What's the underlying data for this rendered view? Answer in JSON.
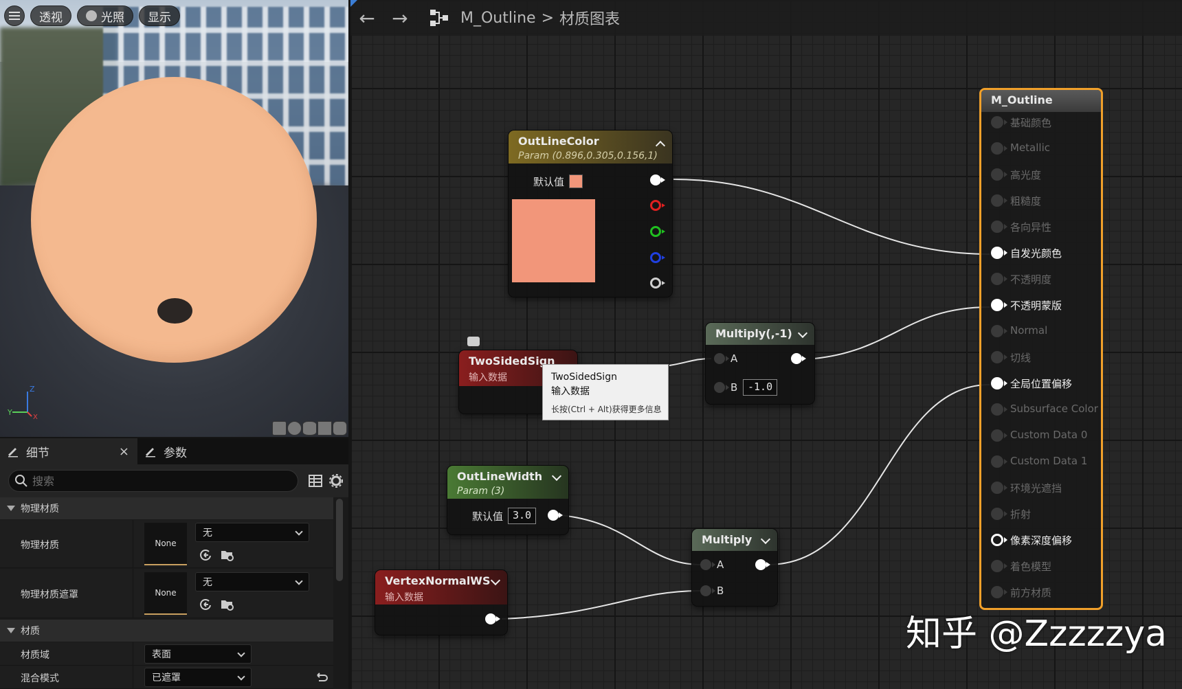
{
  "viewport": {
    "menu_icon": "hamburger-icon",
    "buttons": {
      "perspective": "透视",
      "lighting": "光照",
      "show": "显示"
    }
  },
  "details": {
    "tabs": {
      "details": "细节",
      "close": "×",
      "params": "参数"
    },
    "search": {
      "placeholder": "搜索"
    },
    "categories": {
      "physical_material": "物理材质",
      "material": "材质"
    },
    "rows": {
      "phys_mat": {
        "label": "物理材质",
        "thumb": "None",
        "value": "无"
      },
      "phys_mat_mask": {
        "label": "物理材质遮罩",
        "thumb": "None",
        "value": "无"
      },
      "material_domain": {
        "label": "材质域",
        "value": "表面"
      },
      "blend_mode": {
        "label": "混合模式",
        "value": "已遮罩"
      }
    }
  },
  "graph": {
    "breadcrumb": {
      "asset": "M_Outline",
      "separator": ">",
      "page": "材质图表"
    },
    "nodes": {
      "outline_color": {
        "title": "OutLineColor",
        "sub": "Param (0.896,0.305,0.156,1)",
        "default_label": "默认值",
        "swatch": "#f2967a"
      },
      "two_sided": {
        "title": "TwoSidedSign",
        "sub": "输入数据"
      },
      "multiply_neg": {
        "title": "Multiply(,-1)",
        "pin_a": "A",
        "pin_b": "B",
        "b_value": "-1.0"
      },
      "outline_width": {
        "title": "OutLineWidth",
        "sub": "Param (3)",
        "default_label": "默认值",
        "value": "3.0"
      },
      "multiply": {
        "title": "Multiply",
        "pin_a": "A",
        "pin_b": "B"
      },
      "vertex_normal": {
        "title": "VertexNormalWS",
        "sub": "输入数据"
      }
    },
    "result": {
      "title": "M_Outline",
      "pins": [
        {
          "label": "基础颜色",
          "active": false
        },
        {
          "label": "Metallic",
          "active": false
        },
        {
          "label": "高光度",
          "active": false
        },
        {
          "label": "粗糙度",
          "active": false
        },
        {
          "label": "各向异性",
          "active": false
        },
        {
          "label": "自发光颜色",
          "active": true
        },
        {
          "label": "不透明度",
          "active": false
        },
        {
          "label": "不透明蒙版",
          "active": true
        },
        {
          "label": "Normal",
          "active": false
        },
        {
          "label": "切线",
          "active": false
        },
        {
          "label": "全局位置偏移",
          "active": true
        },
        {
          "label": "Subsurface Color",
          "active": false
        },
        {
          "label": "Custom Data 0",
          "active": false
        },
        {
          "label": "Custom Data 1",
          "active": false
        },
        {
          "label": "环境光遮挡",
          "active": false
        },
        {
          "label": "折射",
          "active": false
        },
        {
          "label": "像素深度偏移",
          "active": true
        },
        {
          "label": "着色模型",
          "active": false
        },
        {
          "label": "前方材质",
          "active": false
        }
      ]
    },
    "tooltip": {
      "line1": "TwoSidedSign",
      "line2": "输入数据",
      "line3": "长按(Ctrl + Alt)获得更多信息"
    }
  },
  "watermark": "知乎 @Zzzzzya",
  "colors": {
    "accent_orange": "#f1a02a",
    "param_header": "#7e6a22",
    "input_header": "#7a1b1b",
    "scalar_header": "#4a7a34",
    "math_header": "#4b5a4a"
  }
}
